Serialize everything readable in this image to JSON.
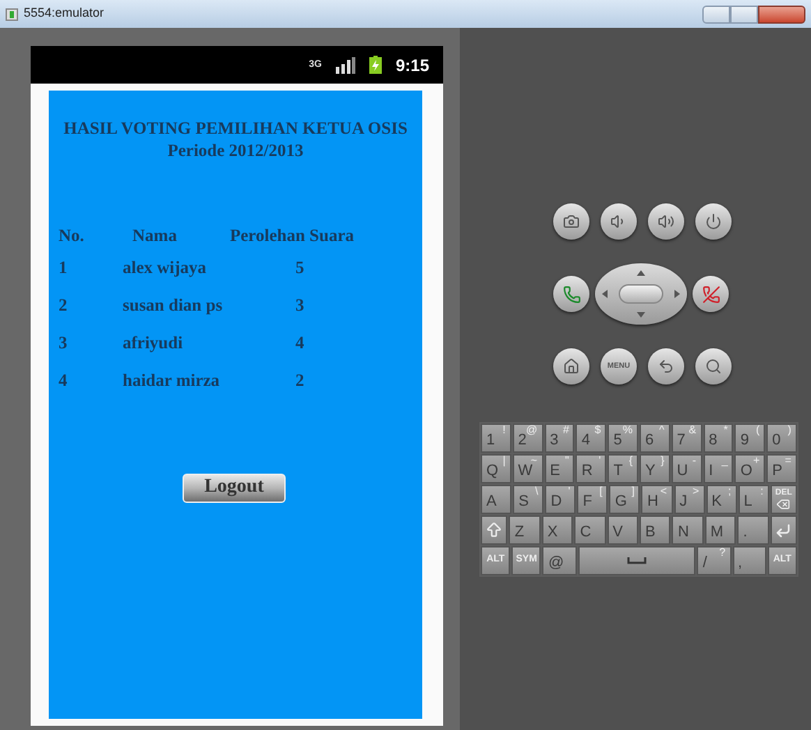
{
  "window": {
    "title": "5554:emulator"
  },
  "status_bar": {
    "network": "3G",
    "time": "9:15"
  },
  "page": {
    "title": "HASIL VOTING PEMILIHAN KETUA OSIS",
    "subtitle": "Periode 2012/2013",
    "table": {
      "columns": [
        "No.",
        "Nama",
        "Perolehan Suara"
      ],
      "rows": [
        {
          "no": "1",
          "name": "alex wijaya",
          "votes": "5"
        },
        {
          "no": "2",
          "name": "susan dian ps",
          "votes": "3"
        },
        {
          "no": "3",
          "name": "afriyudi",
          "votes": "4"
        },
        {
          "no": "4",
          "name": "haidar mirza",
          "votes": "2"
        }
      ]
    },
    "logout_button": "Logout"
  },
  "controls": {
    "menu_label": "MENU"
  },
  "keyboard": {
    "rows": [
      {
        "keys": [
          {
            "kind": "char",
            "label": "1",
            "alt": "!"
          },
          {
            "kind": "char",
            "label": "2",
            "alt": "@"
          },
          {
            "kind": "char",
            "label": "3",
            "alt": "#"
          },
          {
            "kind": "char",
            "label": "4",
            "alt": "$"
          },
          {
            "kind": "char",
            "label": "5",
            "alt": "%"
          },
          {
            "kind": "char",
            "label": "6",
            "alt": "^"
          },
          {
            "kind": "char",
            "label": "7",
            "alt": "&"
          },
          {
            "kind": "char",
            "label": "8",
            "alt": "*"
          },
          {
            "kind": "char",
            "label": "9",
            "alt": "("
          },
          {
            "kind": "char",
            "label": "0",
            "alt": ")"
          }
        ]
      },
      {
        "keys": [
          {
            "kind": "char",
            "label": "Q",
            "alt": "|"
          },
          {
            "kind": "char",
            "label": "W",
            "alt": "~"
          },
          {
            "kind": "char",
            "label": "E",
            "alt": "\""
          },
          {
            "kind": "char",
            "label": "R",
            "alt": "'"
          },
          {
            "kind": "char",
            "label": "T",
            "alt": "{"
          },
          {
            "kind": "char",
            "label": "Y",
            "alt": "}"
          },
          {
            "kind": "char",
            "label": "U",
            "alt": "-"
          },
          {
            "kind": "char",
            "label": "I",
            "alt": "_"
          },
          {
            "kind": "char",
            "label": "O",
            "alt": "+"
          },
          {
            "kind": "char",
            "label": "P",
            "alt": "="
          }
        ]
      },
      {
        "keys": [
          {
            "kind": "char",
            "label": "A"
          },
          {
            "kind": "char",
            "label": "S",
            "alt": "\\"
          },
          {
            "kind": "char",
            "label": "D",
            "alt": "'"
          },
          {
            "kind": "char",
            "label": "F",
            "alt": "["
          },
          {
            "kind": "char",
            "label": "G",
            "alt": "]"
          },
          {
            "kind": "char",
            "label": "H",
            "alt": "<"
          },
          {
            "kind": "char",
            "label": "J",
            "alt": ">"
          },
          {
            "kind": "char",
            "label": "K",
            "alt": ";"
          },
          {
            "kind": "char",
            "label": "L",
            "alt": ":"
          },
          {
            "kind": "del",
            "label": "DEL"
          }
        ]
      },
      {
        "keys": [
          {
            "kind": "shift"
          },
          {
            "kind": "char",
            "label": "Z"
          },
          {
            "kind": "char",
            "label": "X"
          },
          {
            "kind": "char",
            "label": "C"
          },
          {
            "kind": "char",
            "label": "V"
          },
          {
            "kind": "char",
            "label": "B"
          },
          {
            "kind": "char",
            "label": "N"
          },
          {
            "kind": "char",
            "label": "M"
          },
          {
            "kind": "char",
            "label": "."
          },
          {
            "kind": "enter"
          }
        ]
      },
      {
        "keys": [
          {
            "kind": "small",
            "label": "ALT"
          },
          {
            "kind": "small",
            "label": "SYM"
          },
          {
            "kind": "char",
            "label": "@"
          },
          {
            "kind": "space"
          },
          {
            "kind": "char",
            "label": "/",
            "alt": "?"
          },
          {
            "kind": "char",
            "label": ","
          },
          {
            "kind": "small",
            "label": "ALT"
          }
        ]
      }
    ]
  }
}
